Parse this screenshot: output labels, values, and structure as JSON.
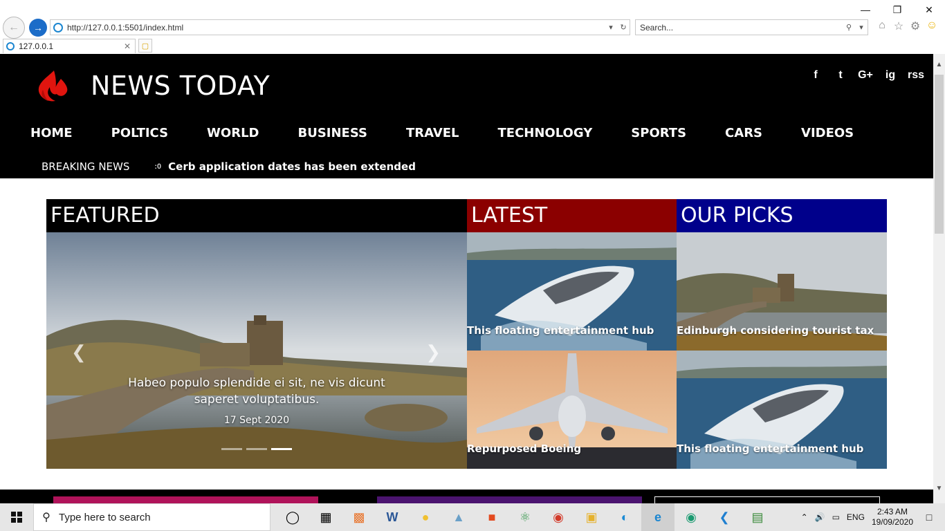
{
  "browser": {
    "url": "http://127.0.0.1:5501/index.html",
    "search_placeholder": "Search...",
    "tab_title": "127.0.0.1"
  },
  "site": {
    "title": "NEWS TODAY",
    "social": [
      "f",
      "t",
      "G+",
      "ig",
      "rss"
    ],
    "nav": [
      "HOME",
      "POLTICS",
      "WORLD",
      "BUSINESS",
      "TRAVEL",
      "TECHNOLOGY",
      "SPORTS",
      "CARS",
      "VIDEOS"
    ],
    "breaking_label": "BREAKING NEWS",
    "breaking_number": ":0",
    "breaking_text": "Cerb application dates has been extended"
  },
  "sections": {
    "featured": "FEATURED",
    "latest": "LATEST",
    "picks": "OUR PICKS"
  },
  "carousel": {
    "caption": "Habeo populo splendide ei sit, ne vis dicunt saperet voluptatibus.",
    "date": "17 Sept 2020",
    "active_index": 2
  },
  "latest": [
    {
      "caption": "This floating entertainment hub"
    },
    {
      "caption": "Repurposed Boeing"
    }
  ],
  "picks": [
    {
      "caption": "Edinburgh considering tourist tax"
    },
    {
      "caption": "This floating entertainment hub"
    }
  ],
  "colors": {
    "latest": "#8b0000",
    "picks": "#00008b",
    "header": "#000000"
  },
  "taskbar": {
    "search_placeholder": "Type here to search",
    "lang": "ENG",
    "time": "2:43 AM",
    "date": "19/09/2020"
  }
}
